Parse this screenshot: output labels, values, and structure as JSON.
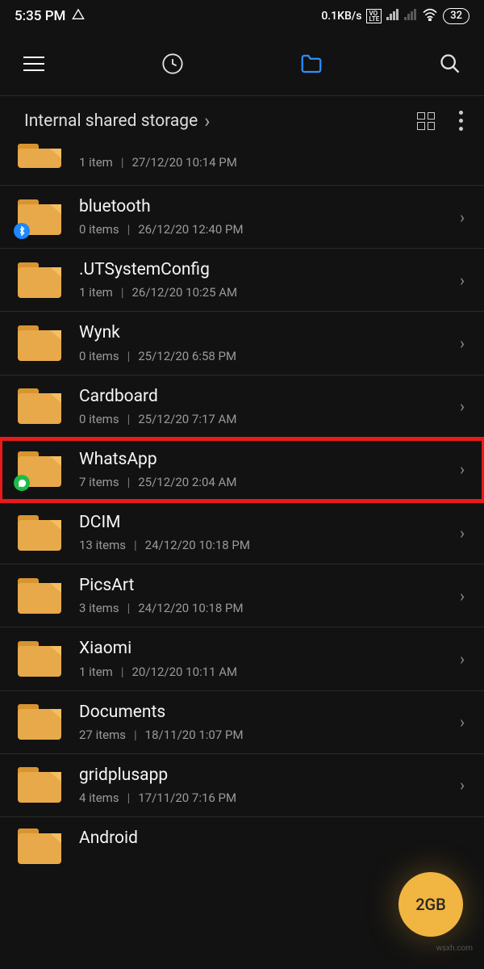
{
  "status": {
    "time": "5:35 PM",
    "warning_icon": "△",
    "net_speed": "0.1KB/s",
    "volte": "VO LTE",
    "battery": "32"
  },
  "toolbar": {
    "menu": "menu",
    "recent": "recent",
    "files": "files",
    "search": "search"
  },
  "path": {
    "breadcrumb": "Internal shared storage",
    "chevron": "›"
  },
  "fab": {
    "label": "2GB"
  },
  "folders": [
    {
      "name": "",
      "count": "1 item",
      "date": "27/12/20 10:14 PM",
      "badge": null,
      "partial": "top"
    },
    {
      "name": "bluetooth",
      "count": "0 items",
      "date": "26/12/20 12:40 PM",
      "badge": "bt"
    },
    {
      "name": ".UTSystemConfig",
      "count": "1 item",
      "date": "26/12/20 10:25 AM",
      "badge": null
    },
    {
      "name": "Wynk",
      "count": "0 items",
      "date": "25/12/20 6:58 PM",
      "badge": null
    },
    {
      "name": "Cardboard",
      "count": "0 items",
      "date": "25/12/20 7:17 AM",
      "badge": null
    },
    {
      "name": "WhatsApp",
      "count": "7 items",
      "date": "25/12/20 2:04 AM",
      "badge": "wa",
      "highlight": true
    },
    {
      "name": "DCIM",
      "count": "13 items",
      "date": "24/12/20 10:18 PM",
      "badge": null
    },
    {
      "name": "PicsArt",
      "count": "3 items",
      "date": "24/12/20 10:18 PM",
      "badge": null
    },
    {
      "name": "Xiaomi",
      "count": "1 item",
      "date": "20/12/20 10:11 AM",
      "badge": null
    },
    {
      "name": "Documents",
      "count": "27 items",
      "date": "18/11/20 1:07 PM",
      "badge": null
    },
    {
      "name": "gridplusapp",
      "count": "4 items",
      "date": "17/11/20 7:16 PM",
      "badge": null
    },
    {
      "name": "Android",
      "count": "",
      "date": "",
      "badge": null,
      "partial": "bottom"
    }
  ],
  "watermark": "wsxh.com"
}
